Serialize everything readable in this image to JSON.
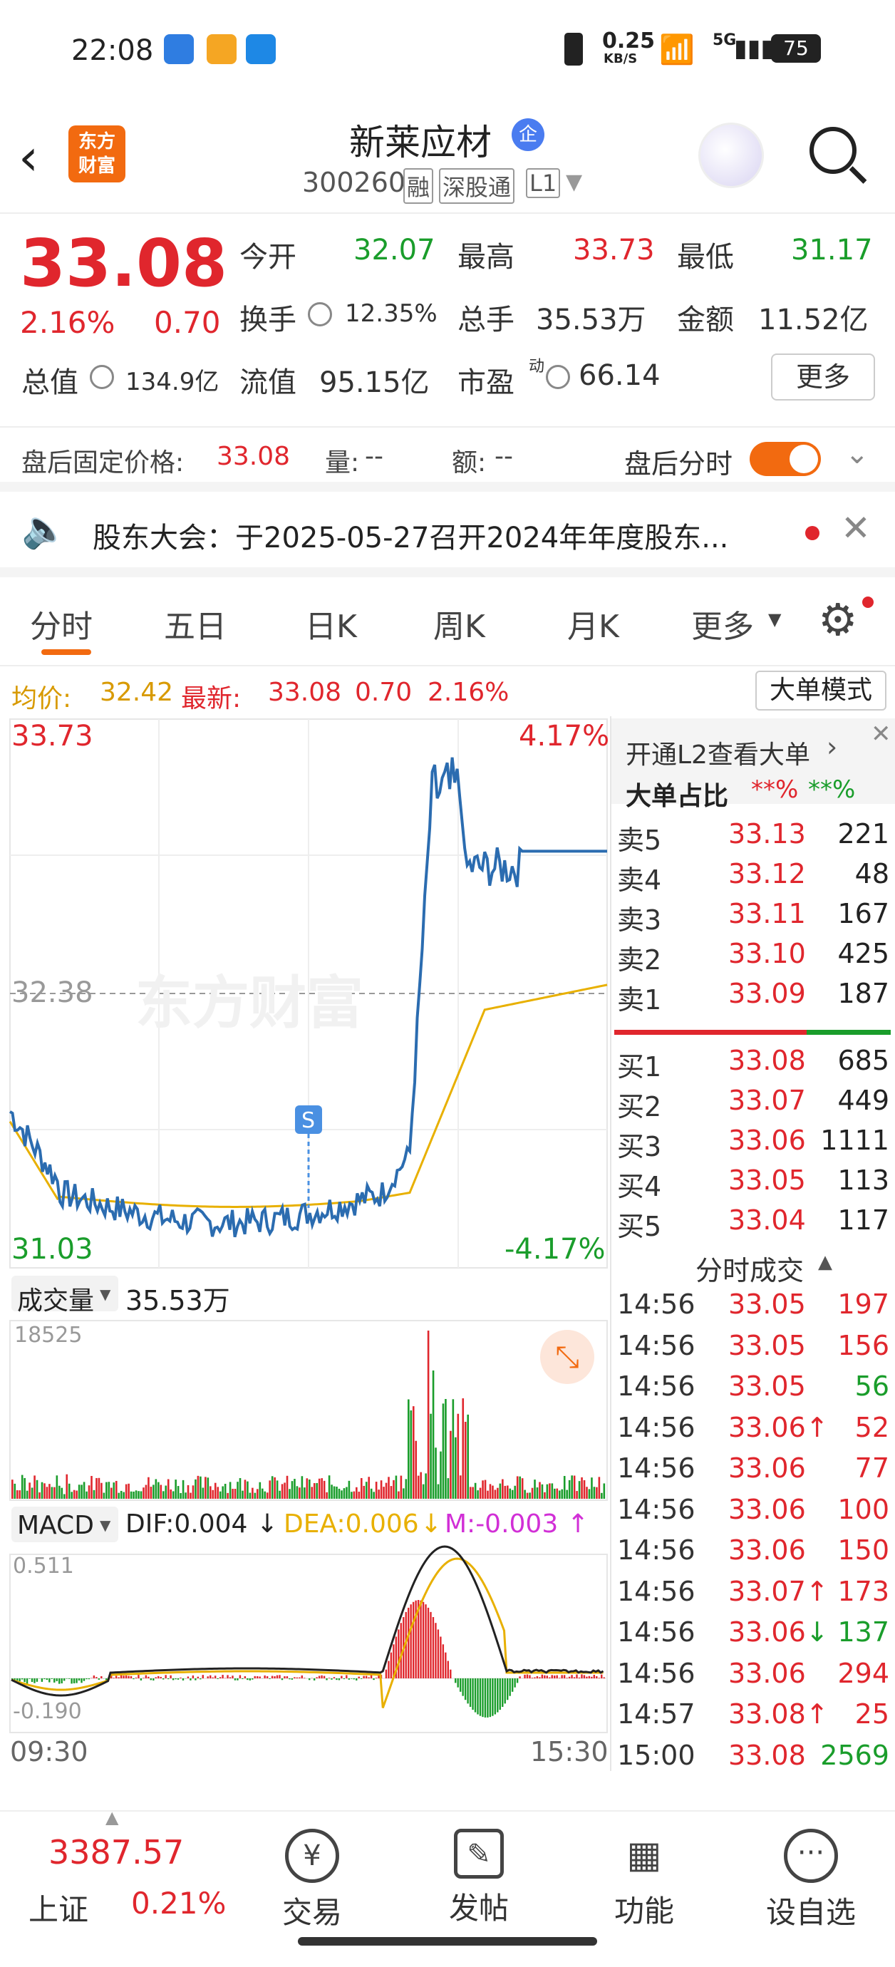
{
  "status": {
    "time": "22:08",
    "net_speed": "0.25",
    "net_unit": "KB/S",
    "net": "5G",
    "battery": "75"
  },
  "header": {
    "title": "新莱应材",
    "badge": "企",
    "code": "300260",
    "tags": [
      "融",
      "深股通",
      "L1"
    ],
    "logo": "东方\n财富"
  },
  "quote": {
    "price": "33.08",
    "change_pct": "2.16%",
    "change": "0.70",
    "open_label": "今开",
    "open": "32.07",
    "high_label": "最高",
    "high": "33.73",
    "low_label": "最低",
    "low": "31.17",
    "turnover_label": "换手",
    "turnover": "12.35%",
    "volume_label": "总手",
    "volume": "35.53万",
    "amount_label": "金额",
    "amount": "11.52亿",
    "mktcap_label": "总值",
    "mktcap": "134.9亿",
    "float_label": "流值",
    "float": "95.15亿",
    "pe_label": "市盈",
    "pe_sup": "动",
    "pe": "66.14",
    "more": "更多"
  },
  "after": {
    "fixed_label": "盘后固定价格:",
    "fixed_price": "33.08",
    "vol_label": "量:",
    "vol": "--",
    "amt_label": "额:",
    "amt": "--",
    "toggle_label": "盘后分时"
  },
  "notice": {
    "text": "股东大会：于2025-05-27召开2024年年度股东..."
  },
  "tabs": [
    "分时",
    "五日",
    "日K",
    "周K",
    "月K",
    "更多"
  ],
  "summary": {
    "avg_label": "均价:",
    "avg": "32.42",
    "latest_label": "最新:",
    "latest": "33.08",
    "chg": "0.70",
    "pct": "2.16%",
    "mode_btn": "大单模式"
  },
  "chart": {
    "top_price": "33.73",
    "top_pct": "4.17%",
    "mid_price": "32.38",
    "bot_price": "31.03",
    "bot_pct": "-4.17%",
    "watermark": "东方财富",
    "s_marker": "S",
    "start_time": "09:30",
    "end_time": "15:30"
  },
  "volume": {
    "label": "成交量",
    "total": "35.53万",
    "max": "18525"
  },
  "macd": {
    "label": "MACD",
    "dif": "DIF:0.004",
    "dea": "DEA:0.006",
    "m": "M:-0.003",
    "top": "0.511",
    "bot": "-0.190"
  },
  "l2": {
    "link": "开通L2查看大单",
    "ratio_label": "大单占比",
    "ratio_red": "**%",
    "ratio_green": "**%"
  },
  "asks": [
    {
      "l": "卖5",
      "p": "33.13",
      "v": "221"
    },
    {
      "l": "卖4",
      "p": "33.12",
      "v": "48"
    },
    {
      "l": "卖3",
      "p": "33.11",
      "v": "167"
    },
    {
      "l": "卖2",
      "p": "33.10",
      "v": "425"
    },
    {
      "l": "卖1",
      "p": "33.09",
      "v": "187"
    }
  ],
  "bids": [
    {
      "l": "买1",
      "p": "33.08",
      "v": "685"
    },
    {
      "l": "买2",
      "p": "33.07",
      "v": "449"
    },
    {
      "l": "买3",
      "p": "33.06",
      "v": "1111"
    },
    {
      "l": "买4",
      "p": "33.05",
      "v": "113"
    },
    {
      "l": "买5",
      "p": "33.04",
      "v": "117"
    }
  ],
  "trades_label": "分时成交",
  "trades": [
    {
      "t": "14:56",
      "p": "33.05",
      "v": "197",
      "c": "red"
    },
    {
      "t": "14:56",
      "p": "33.05",
      "v": "156",
      "c": "red"
    },
    {
      "t": "14:56",
      "p": "33.05",
      "v": "56",
      "c": "green"
    },
    {
      "t": "14:56",
      "p": "33.06↑",
      "v": "52",
      "c": "red"
    },
    {
      "t": "14:56",
      "p": "33.06",
      "v": "77",
      "c": "red"
    },
    {
      "t": "14:56",
      "p": "33.06",
      "v": "100",
      "c": "red"
    },
    {
      "t": "14:56",
      "p": "33.06",
      "v": "150",
      "c": "red"
    },
    {
      "t": "14:56",
      "p": "33.07↑",
      "v": "173",
      "c": "red"
    },
    {
      "t": "14:56",
      "p": "33.06↓",
      "v": "137",
      "c": "green"
    },
    {
      "t": "14:56",
      "p": "33.06",
      "v": "294",
      "c": "red"
    },
    {
      "t": "14:57",
      "p": "33.08↑",
      "v": "25",
      "c": "red"
    },
    {
      "t": "15:00",
      "p": "33.08",
      "v": "2569",
      "c": "green"
    }
  ],
  "bottom": {
    "index_val": "3387.57",
    "index_name": "上证",
    "index_pct": "0.21%",
    "items": [
      "交易",
      "发帖",
      "功能",
      "设自选"
    ]
  }
}
